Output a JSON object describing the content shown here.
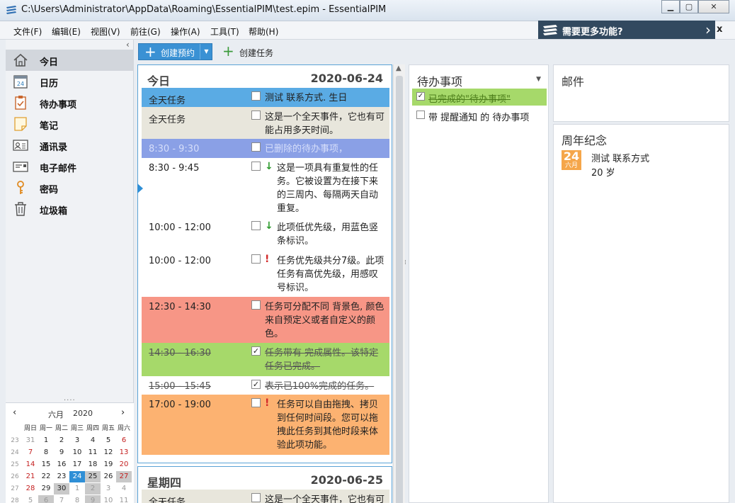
{
  "window": {
    "title": "C:\\Users\\Administrator\\AppData\\Roaming\\EssentialPIM\\test.epim - EssentialPIM",
    "minimize_glyph": "▁",
    "maximize_glyph": "▢",
    "close_glyph": "✕"
  },
  "menu": [
    "文件(F)",
    "编辑(E)",
    "视图(V)",
    "前往(G)",
    "操作(A)",
    "工具(T)",
    "帮助(H)"
  ],
  "promo": {
    "text": "需要更多功能?",
    "chevron": "›",
    "close": "x"
  },
  "sidebar": {
    "collapse_glyph": "‹",
    "items": [
      {
        "label": "今日",
        "icon": "home-icon",
        "active": true
      },
      {
        "label": "日历",
        "icon": "calendar-icon",
        "active": false
      },
      {
        "label": "待办事项",
        "icon": "clipboard-icon",
        "active": false
      },
      {
        "label": "笔记",
        "icon": "note-icon",
        "active": false
      },
      {
        "label": "通讯录",
        "icon": "contact-card-icon",
        "active": false
      },
      {
        "label": "电子邮件",
        "icon": "email-icon",
        "active": false
      },
      {
        "label": "密码",
        "icon": "key-icon",
        "active": false
      },
      {
        "label": "垃圾箱",
        "icon": "trash-icon",
        "active": false
      }
    ]
  },
  "minical": {
    "month": "六月",
    "year": "2020",
    "prev": "‹",
    "next": "›",
    "weekdays": [
      "周日",
      "周一",
      "周二",
      "周三",
      "周四",
      "周五",
      "周六"
    ],
    "weeks": [
      {
        "wk": "23",
        "days": [
          "31",
          "1",
          "2",
          "3",
          "4",
          "5",
          "6"
        ]
      },
      {
        "wk": "24",
        "days": [
          "7",
          "8",
          "9",
          "10",
          "11",
          "12",
          "13"
        ]
      },
      {
        "wk": "25",
        "days": [
          "14",
          "15",
          "16",
          "17",
          "18",
          "19",
          "20"
        ]
      },
      {
        "wk": "26",
        "days": [
          "21",
          "22",
          "23",
          "24",
          "25",
          "26",
          "27"
        ]
      },
      {
        "wk": "27",
        "days": [
          "28",
          "29",
          "30",
          "1",
          "2",
          "3",
          "4"
        ]
      },
      {
        "wk": "28",
        "days": [
          "5",
          "6",
          "7",
          "8",
          "9",
          "10",
          "11"
        ]
      }
    ],
    "today": "24"
  },
  "toolbar": {
    "new_appointment": "创建预约",
    "new_task": "创建任务",
    "plus": "+",
    "dropdown": "▼"
  },
  "today": {
    "day_name": "今日",
    "date": "2020-06-24",
    "events": [
      {
        "time": "全天任务",
        "text": "测试 联系方式. 生日",
        "color": "#5aabe4",
        "checked": false,
        "marker": "",
        "state": "normal"
      },
      {
        "time": "全天任务",
        "text": "这是一个全天事件，它也有可能占用多天时间。",
        "color": "#e8e6dc",
        "checked": false,
        "marker": "",
        "state": "normal"
      },
      {
        "time": "8:30 - 9:30",
        "text": "已删除的待办事项，",
        "color": "#8aa0e6",
        "checked": false,
        "marker": "",
        "state": "faint"
      },
      {
        "time": "8:30 - 9:45",
        "text": "这是一项具有重复性的任务。它被设置为在接下来的三周内、每隔两天自动重复。",
        "color": "#ffffff",
        "checked": false,
        "marker": "↓",
        "marker_color": "#2e9b2e",
        "state": "normal"
      },
      {
        "time": "10:00 - 12:00",
        "text": "此项低优先级，用蓝色竖条标识。",
        "color": "#ffffff",
        "checked": false,
        "marker": "↓",
        "marker_color": "#2e9b2e",
        "state": "normal"
      },
      {
        "time": "10:00 - 12:00",
        "text": "任务优先级共分7级。此项任务有高优先级，用感叹号标识。",
        "color": "#ffffff",
        "checked": false,
        "marker": "!",
        "marker_color": "#d22a2a",
        "state": "normal"
      },
      {
        "time": "12:30 - 14:30",
        "text": "任务可分配不同 背景色, 颜色来自预定义或者自定义的颜色。",
        "color": "#f79686",
        "checked": false,
        "marker": "",
        "state": "normal"
      },
      {
        "time": "14:30 - 16:30",
        "text": "任务带有 完成属性。该特定任务已完成。",
        "color": "#a6d96a",
        "checked": true,
        "marker": "",
        "state": "done"
      },
      {
        "time": "15:00 - 15:45",
        "text": "表示已100%完成的任务。",
        "color": "#ffffff",
        "checked": true,
        "marker": "",
        "state": "done"
      },
      {
        "time": "17:00 - 19:00",
        "text": "任务可以自由拖拽、拷贝到任何时间段。您可以拖拽此任务到其他时段来体验此项功能。",
        "color": "#fcb271",
        "checked": false,
        "marker": "!",
        "marker_color": "#d22a2a",
        "state": "normal"
      }
    ]
  },
  "thursday": {
    "day_name": "星期四",
    "date": "2020-06-25",
    "events": [
      {
        "time": "全天任务",
        "text": "这是一个全天事件，它也有可",
        "color": "#e8e6dc",
        "checked": false
      }
    ]
  },
  "todo": {
    "title": "待办事项",
    "dropdown": "▼",
    "items": [
      {
        "text": "已完成的\"待办事项\"",
        "checked": true
      },
      {
        "text": "带 提醒通知 的 待办事项",
        "checked": false
      }
    ]
  },
  "mail": {
    "title": "邮件"
  },
  "anniversary": {
    "title": "周年纪念",
    "icon_day": "24",
    "icon_month": "六月",
    "name": "测试 联系方式",
    "age": "20 岁"
  }
}
